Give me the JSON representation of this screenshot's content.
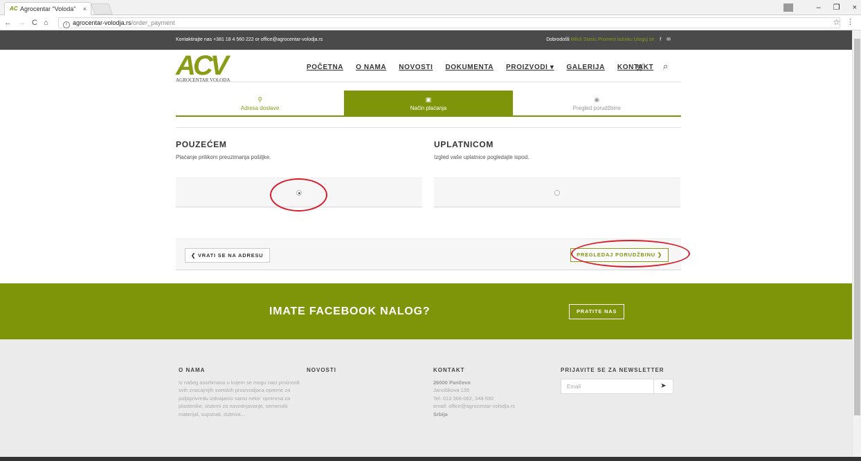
{
  "browser": {
    "tab_title": "Agrocentar \"Voloda\"",
    "tab_close": "×",
    "url_host": "agrocentar-volodja.rs",
    "url_path": "/order_payment",
    "min": "–",
    "max": "❐",
    "close": "×"
  },
  "topbar": {
    "contact": "Kontaktirajte nas +381 18 4 560 222 or office@agrocentar-volodja.rs",
    "welcome_prefix": "Dobrodošli",
    "welcome_links": "Miloš Stasic Promeni lozinku Izloguj se"
  },
  "header": {
    "logo_mark": "ACV",
    "logo_name": "AGROCENTAR VOLODA",
    "nav": [
      "POČETNA",
      "O NAMA",
      "NOVOSTI",
      "DOKUMENTA",
      "PROIZVODI ▾",
      "GALERIJA",
      "KONTAKT"
    ]
  },
  "steps": [
    {
      "icon": "⚲",
      "label": "Adresa dostave"
    },
    {
      "icon": "▣",
      "label": "Način plaćanja"
    },
    {
      "icon": "◉",
      "label": "Pregled porudžbine"
    }
  ],
  "payment": {
    "cod_title": "POUZEĆEM",
    "cod_desc": "Plaćanje prilikom preuzimanja pošiljke.",
    "slip_title": "UPLATNICOM",
    "slip_desc": "Izgled vaše uplatnice pogledajte ispod.",
    "selected": "cod"
  },
  "actions": {
    "back": "❮ VRATI SE NA ADRESU",
    "review": "PREGLEDAJ PORUDŽBINU ❯"
  },
  "facebook": {
    "heading": "IMATE FACEBOOK NALOG?",
    "button": "PRATITE NAS"
  },
  "footer": {
    "about_title": "O NAMA",
    "about_text": "Iz našeg asortimana u kojem se mogu naci proizvodi svih znacajnijih svetskih proizvodjaca opreme za poljoprivredu izdvajamo samo neke: oprenma za plastenike, sistemi za navodnjavanje, semenski materijal, supstrati, dubriva...",
    "news_title": "NOVOSTI",
    "contact_title": "KONTAKT",
    "contact_city": "26000 Pančevo",
    "contact_street": "Janošikova 135",
    "contact_tel": "Tel: 013 366-062, 348-592",
    "contact_email": "email: office@agrocentar-volodja.rs",
    "contact_country": "Srbija",
    "newsletter_title": "PRIJAVITE SE ZA NEWSLETTER",
    "newsletter_placeholder": "Email"
  },
  "colors": {
    "brand_green": "#7e9409",
    "annotation_red": "#d81e2c"
  }
}
